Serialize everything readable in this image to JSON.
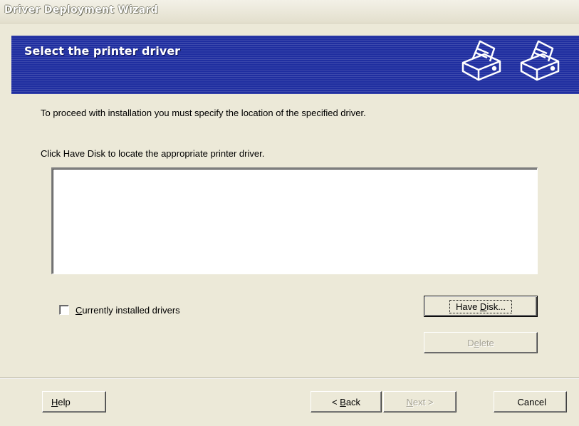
{
  "window": {
    "title": "Driver Deployment Wizard"
  },
  "banner": {
    "heading": "Select the printer driver",
    "icons": [
      "printer-icon",
      "printer-icon"
    ]
  },
  "content": {
    "instruction": "To proceed with installation you must specify the location of the specified driver.",
    "prompt": "Click Have Disk to locate the appropriate printer driver.",
    "driver_list": []
  },
  "checkbox": {
    "label_mnemonic": "C",
    "label_rest": "urrently installed drivers",
    "checked": false
  },
  "buttons": {
    "have_disk": {
      "pre": "Have ",
      "mnemonic": "D",
      "post": "isk..."
    },
    "delete": {
      "pre": "D",
      "mnemonic": "e",
      "post": "lete"
    },
    "help": {
      "mnemonic": "H",
      "post": "elp"
    },
    "back": {
      "pre": "< ",
      "mnemonic": "B",
      "post": "ack"
    },
    "next": {
      "mnemonic": "N",
      "post": "ext >"
    },
    "cancel": {
      "label": "Cancel"
    }
  },
  "colors": {
    "banner": "#1f2ea0",
    "dialog": "#ece9d8",
    "disabled_text": "#a6a394"
  }
}
